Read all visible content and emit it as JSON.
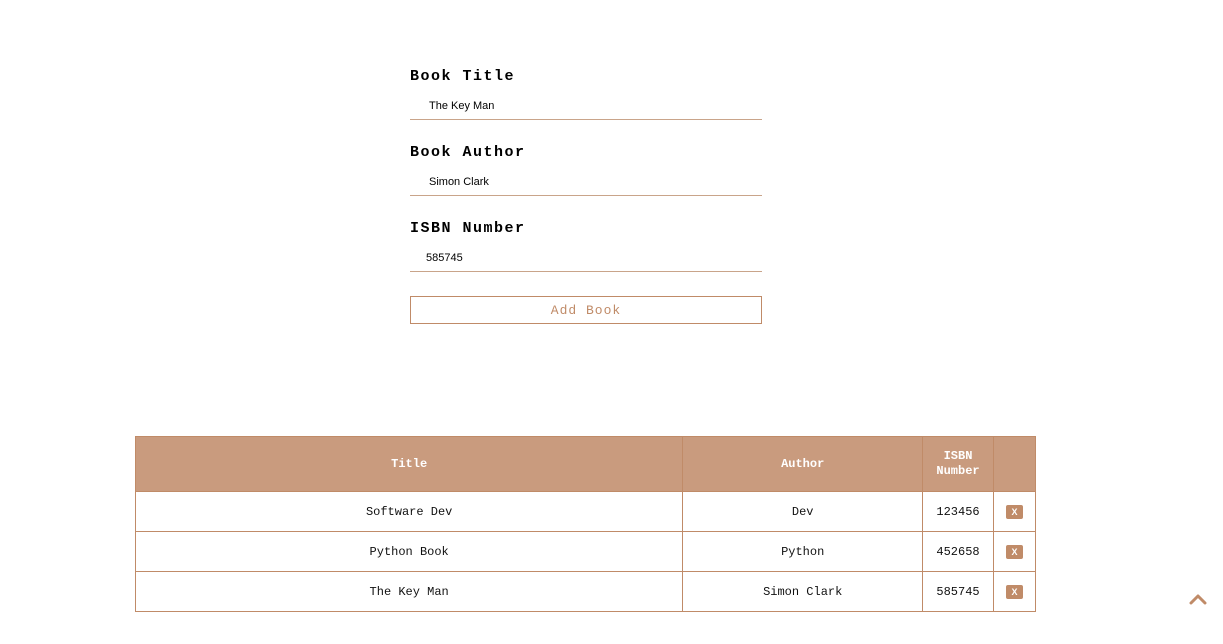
{
  "form": {
    "fields": [
      {
        "label": "Book Title",
        "value": "The Key Man"
      },
      {
        "label": "Book Author",
        "value": "Simon Clark"
      },
      {
        "label": "ISBN Number",
        "value": "585745"
      }
    ],
    "submit_label": "Add Book"
  },
  "table": {
    "headers": {
      "title": "Title",
      "author": "Author",
      "isbn": "ISBN Number"
    },
    "rows": [
      {
        "title": "Software Dev",
        "author": "Dev",
        "isbn": "123456",
        "delete": "X"
      },
      {
        "title": "Python Book",
        "author": "Python",
        "isbn": "452658",
        "delete": "X"
      },
      {
        "title": "The Key Man",
        "author": "Simon Clark",
        "isbn": "585745",
        "delete": "X"
      }
    ]
  },
  "icons": {
    "scroll_top": "chevron-up-icon"
  },
  "colors": {
    "accent": "#c08b68",
    "header_bg": "#c99b7e"
  }
}
